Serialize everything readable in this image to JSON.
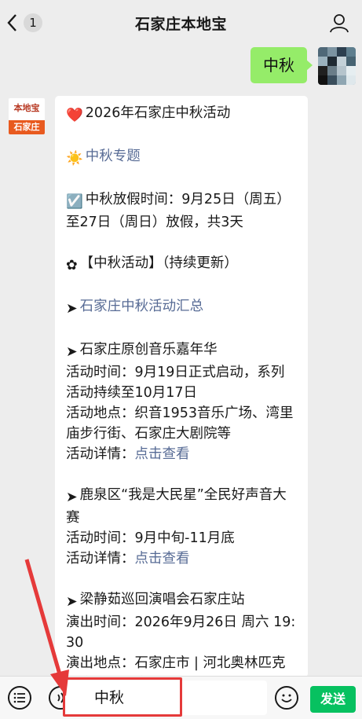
{
  "header": {
    "title": "石家庄本地宝",
    "back_badge": "1",
    "back_icon": "chevron-left-icon",
    "profile_icon": "person-icon"
  },
  "chat": {
    "my_message": "中秋",
    "bot_avatar": {
      "logo_text_top": "本地宝",
      "logo_text_bottom": "石家庄"
    },
    "bot_lines": [
      {
        "icon": "❤️",
        "text": "2026年石家庄中秋活动"
      },
      {
        "gap": true
      },
      {
        "icon": "☀️",
        "text": "中秋专题",
        "link": true
      },
      {
        "gap": true
      },
      {
        "icon": "☑️",
        "text": "中秋放假时间：9月25日（周五）至27日（周日）放假，共3天"
      },
      {
        "gap": true
      },
      {
        "icon": "✿",
        "text": "【中秋活动】（持续更新）"
      },
      {
        "gap": true
      },
      {
        "icon": "➤",
        "text": "石家庄中秋活动汇总",
        "link": true
      },
      {
        "gap": true
      },
      {
        "icon": "➤",
        "text": "石家庄原创音乐嘉年华"
      },
      {
        "text": "活动时间：9月19日正式启动，系列活动持续至10月17日"
      },
      {
        "text": "活动地点：织音1953音乐广场、湾里庙步行街、石家庄大剧院等"
      },
      {
        "text": "活动详情：",
        "link_text": "点击查看"
      },
      {
        "gap": true
      },
      {
        "icon": "➤",
        "text": "鹿泉区“我是大民星”全民好声音大赛"
      },
      {
        "text": "活动时间：9月中旬-11月底"
      },
      {
        "text": "活动详情：",
        "link_text": "点击查看"
      },
      {
        "gap": true
      },
      {
        "icon": "➤",
        "text": "梁静茹巡回演唱会石家庄站"
      },
      {
        "text": "演出时间：2026年9月26日 周六 19:30"
      },
      {
        "text": "演出地点：石家庄市 | 河北奥林匹克体育中心体育场"
      }
    ]
  },
  "input_bar": {
    "voice_icon": "list-icon",
    "audio_icon": "voice-wave-icon",
    "input_value": "中秋",
    "emoji_icon": "smiley-icon",
    "send_label": "发送"
  },
  "colors": {
    "accent_green": "#95ec69",
    "send_green": "#07c160",
    "link_blue": "#576b95",
    "annotation_red": "#e53a3a"
  }
}
